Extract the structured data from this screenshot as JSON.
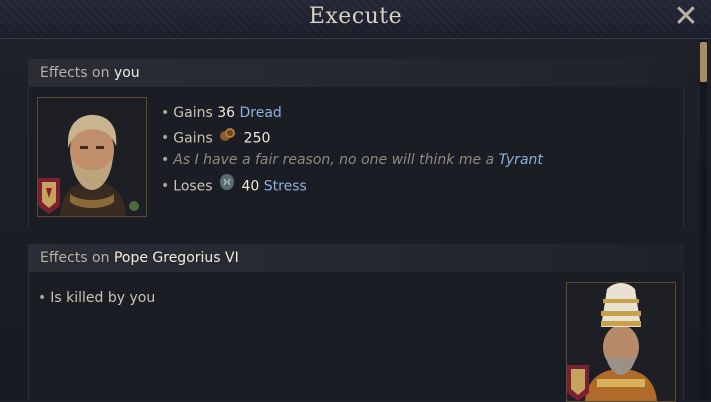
{
  "window": {
    "title": "Execute"
  },
  "icons": {
    "close": "close-icon",
    "gold": "gold-coin-icon",
    "stress": "stress-icon"
  },
  "colors": {
    "accent_blue": "#8fb0d6",
    "highlight": "#f1ece0",
    "muted": "#8e8a82"
  },
  "section_you": {
    "prefix": "Effects on",
    "target": "you",
    "effects": [
      {
        "verb": "Gains",
        "value": "36",
        "term": "Dread"
      },
      {
        "verb": "Gains",
        "value": "250",
        "icon": "gold-coin-icon"
      },
      {
        "note": "As I have a fair reason, no one will think me a",
        "term": "Tyrant"
      },
      {
        "verb": "Loses",
        "value": "40",
        "term": "Stress",
        "icon": "stress-icon"
      }
    ]
  },
  "section_pope": {
    "prefix": "Effects on",
    "target": "Pope Gregorius VI",
    "effects": [
      {
        "text": "Is killed by you"
      }
    ]
  }
}
